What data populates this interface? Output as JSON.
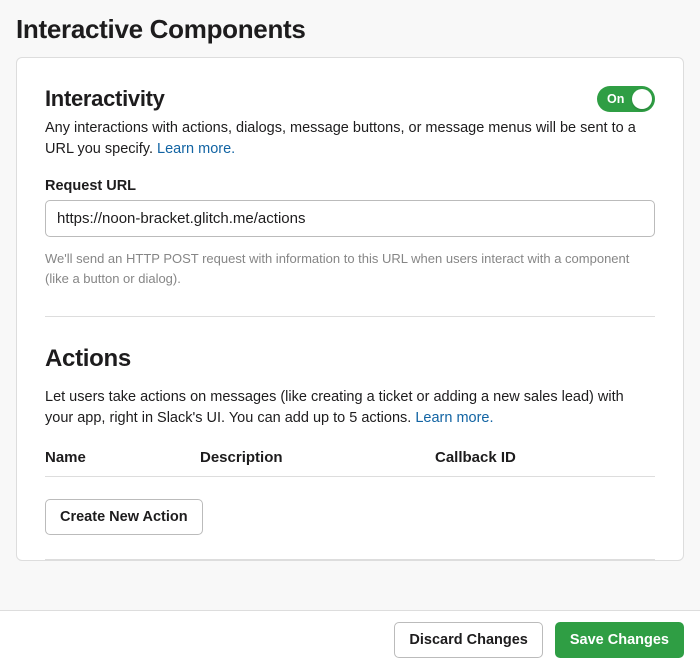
{
  "pageTitle": "Interactive Components",
  "interactivity": {
    "title": "Interactivity",
    "toggleState": "On",
    "description": "Any interactions with actions, dialogs, message buttons, or message menus will be sent to a URL you specify. ",
    "learnMore": "Learn more.",
    "requestUrlLabel": "Request URL",
    "requestUrlValue": "https://noon-bracket.glitch.me/actions",
    "hint": "We'll send an HTTP POST request with information to this URL when users interact with a component (like a button or dialog)."
  },
  "actions": {
    "title": "Actions",
    "description": "Let users take actions on messages (like creating a ticket or adding a new sales lead) with your app, right in Slack's UI. You can add up to 5 actions. ",
    "learnMore": "Learn more.",
    "columns": {
      "name": "Name",
      "description": "Description",
      "callbackId": "Callback ID"
    },
    "createButton": "Create New Action"
  },
  "footer": {
    "discard": "Discard Changes",
    "save": "Save Changes"
  }
}
